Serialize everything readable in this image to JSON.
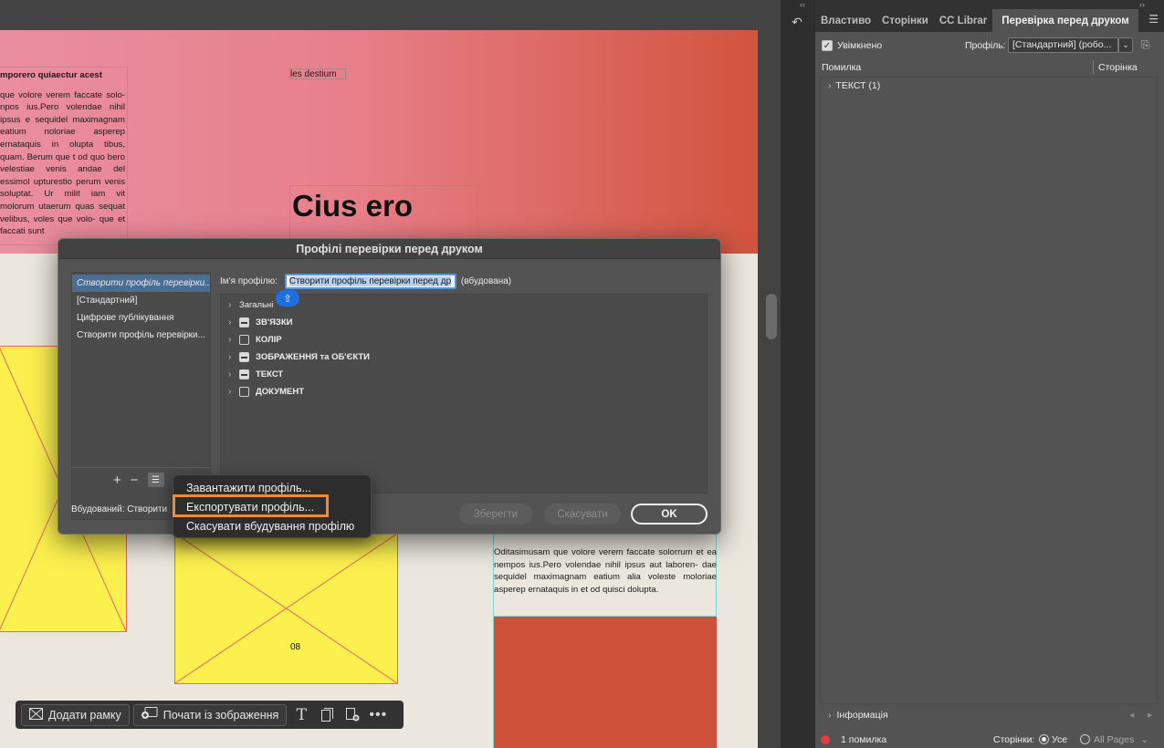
{
  "document": {
    "left_column_heading": "mporero quiaectur acest",
    "left_column_body": "que volore verem faccate solo- npos ius.Pero volendae nihil ipsus e sequidel maximagnam eatium noloriae asperep ernataquis in olupta tibus, quam. Berum que t od quo bero velestiae venis andae del essimol upturestio perum venis soluptat. Ur milit iam vit molorum utaerum quas sequat velibus, voles que volo- que et faccati sunt",
    "small_label": "les destium",
    "big_heading": "Cius ero",
    "right_body": "Oditasimusam que volore verem faccate solorrum et ea nempos ius.Pero volendae nihil ipsus aut laboren- dae sequidel maximagnam eatium alia voleste moloriae asperep ernataquis in et od quisci dolupta.",
    "page_number": "08"
  },
  "floating_toolbar": {
    "add_frame": "Додати рамку",
    "start_from_image": "Почати із зображення"
  },
  "panel": {
    "tabs": [
      "Властиво",
      "Сторінки",
      "CC Librar",
      "Перевірка перед друком"
    ],
    "enabled_label": "Увімкнено",
    "profile_label": "Профіль:",
    "profile_value": "[Стандартний] (робо...",
    "error_col": "Помилка",
    "page_col": "Сторінка",
    "text_item": "ТЕКСТ (1)",
    "info_label": "Інформація",
    "status_errors": "1 помилка",
    "pages_label": "Сторінки:",
    "pages_all": "Усе",
    "pages_select": "All Pages"
  },
  "dialog": {
    "title": "Профілі перевірки перед друком",
    "profiles": [
      "Створити профіль перевірки...",
      "[Стандартний]",
      "Цифрове публікування",
      "Створити профіль перевірки..."
    ],
    "embedded_label": "Вбудований: Створити",
    "profile_name_label": "Ім'я профілю:",
    "profile_name_value": "Створити профіль перевірки перед др",
    "embedded_suffix": "(вбудована)",
    "tree": [
      {
        "label": "Загальні",
        "checkbox": "none"
      },
      {
        "label": "ЗВ'ЯЗКИ",
        "checkbox": "mixed"
      },
      {
        "label": "КОЛІР",
        "checkbox": "empty"
      },
      {
        "label": "ЗОБРАЖЕННЯ та ОБ'ЄКТИ",
        "checkbox": "mixed"
      },
      {
        "label": "ТЕКСТ",
        "checkbox": "mixed"
      },
      {
        "label": "ДОКУМЕНТ",
        "checkbox": "empty"
      }
    ],
    "save": "Зберегти",
    "cancel": "Скасувати",
    "ok": "OK"
  },
  "popup_menu": {
    "load": "Завантажити профіль...",
    "export": "Експортувати профіль...",
    "unembed": "Скасувати вбудування профілю"
  },
  "colors": {
    "highlight": "#f28a2e",
    "selection": "#4a6d94",
    "error_dot": "#e03c3c"
  }
}
